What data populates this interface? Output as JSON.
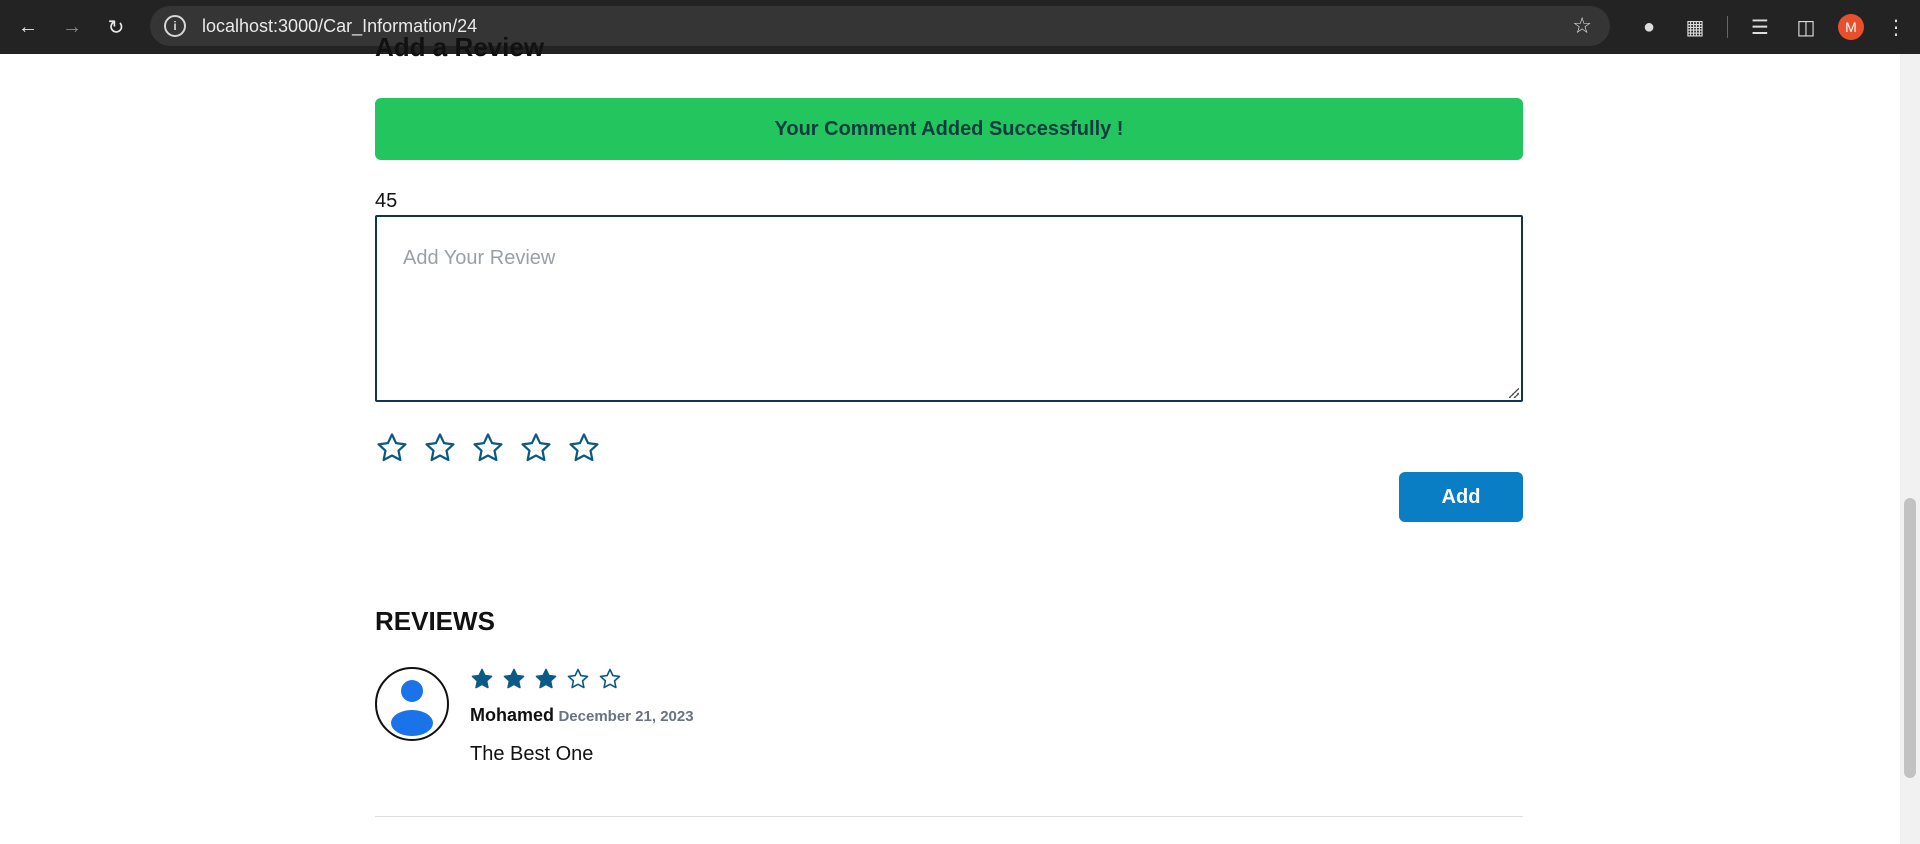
{
  "browser": {
    "url": "localhost:3000/Car_Information/24",
    "profile_initial": "M"
  },
  "form": {
    "title": "Add a Review",
    "success_message": "Your Comment Added Successfully !",
    "char_count": "45",
    "review_placeholder": "Add Your Review",
    "rating_max": 5,
    "rating_selected": 0,
    "add_label": "Add"
  },
  "reviews": {
    "heading": "REVIEWS",
    "items": [
      {
        "author": "Mohamed",
        "date": "December 21, 2023",
        "rating": 3,
        "rating_max": 5,
        "text": "The Best One"
      }
    ]
  },
  "colors": {
    "success": "#22c55e",
    "primary": "#0a7ec4",
    "star": "#0b5a85",
    "avatar_icon": "#1a73e8"
  }
}
